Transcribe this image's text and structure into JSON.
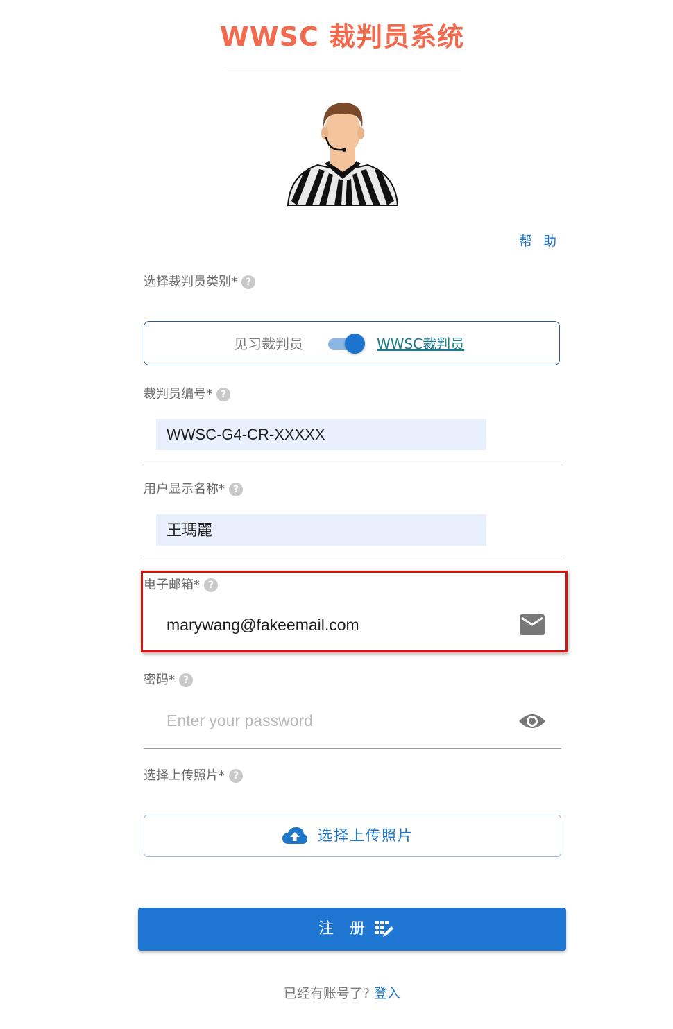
{
  "header": {
    "title": "WWSC 裁判员系统"
  },
  "help_link": "帮 助",
  "referee_type": {
    "label": "选择裁判员类别*",
    "option_left": "见习裁判员",
    "option_right": "WWSC裁判员",
    "toggle_state": "on"
  },
  "referee_number": {
    "label": "裁判员编号*",
    "value": "WWSC-G4-CR-XXXXX"
  },
  "display_name": {
    "label": "用户显示名称*",
    "value": "王瑪麗"
  },
  "email": {
    "label": "电子邮箱*",
    "value": "marywang@fakeemail.com",
    "icon": "mail-icon"
  },
  "password": {
    "label": "密码*",
    "placeholder": "Enter your password",
    "icon": "eye-icon"
  },
  "photo": {
    "label": "选择上传照片*",
    "button_label": "选择上传照片",
    "icon": "cloud-upload-icon"
  },
  "register_button": {
    "label": "注 册",
    "icon": "register-icon"
  },
  "footer": {
    "text": "已经有账号了? ",
    "link": "登入"
  },
  "help_icon_glyph": "?",
  "colors": {
    "title": "#f26b4f",
    "accent": "#1e76d2",
    "highlight_border": "#d9140f",
    "input_fill": "#e8f0fe"
  }
}
